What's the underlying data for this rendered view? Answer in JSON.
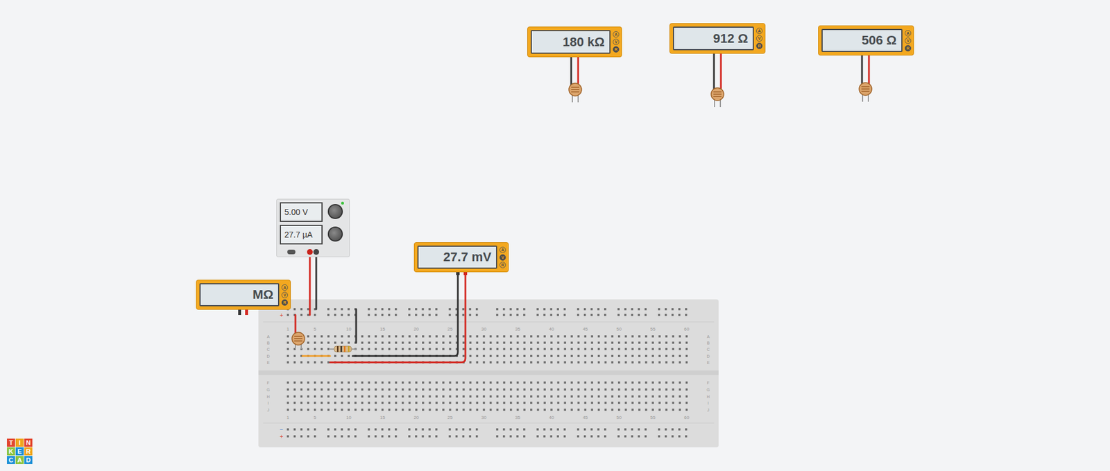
{
  "meters": [
    {
      "reading": "180 kΩ",
      "modes": [
        {
          "label": "A",
          "selected": false
        },
        {
          "label": "V",
          "selected": false
        },
        {
          "label": "R",
          "selected": true
        }
      ]
    },
    {
      "reading": "912 Ω",
      "modes": [
        {
          "label": "A",
          "selected": false
        },
        {
          "label": "V",
          "selected": false
        },
        {
          "label": "R",
          "selected": true
        }
      ]
    },
    {
      "reading": "506 Ω",
      "modes": [
        {
          "label": "A",
          "selected": false
        },
        {
          "label": "V",
          "selected": false
        },
        {
          "label": "R",
          "selected": true
        }
      ]
    },
    {
      "reading": "27.7 mV",
      "modes": [
        {
          "label": "A",
          "selected": false
        },
        {
          "label": "V",
          "selected": true
        },
        {
          "label": "R",
          "selected": false
        }
      ]
    },
    {
      "reading": "MΩ",
      "modes": [
        {
          "label": "A",
          "selected": false
        },
        {
          "label": "V",
          "selected": false
        },
        {
          "label": "R",
          "selected": true
        }
      ]
    }
  ],
  "power_supply": {
    "voltage": "5.00 V",
    "current": "27.7 µA",
    "on": true
  },
  "breadboard": {
    "columns": [
      "1",
      "5",
      "10",
      "15",
      "20",
      "25",
      "30",
      "35",
      "40",
      "45",
      "50",
      "55",
      "60"
    ],
    "rows_top": [
      "A",
      "B",
      "C",
      "D",
      "E"
    ],
    "rows_bottom": [
      "F",
      "G",
      "H",
      "I",
      "J"
    ],
    "rails_top": [
      "−",
      "+"
    ],
    "rails_bottom": [
      "−",
      "+"
    ]
  },
  "logo": [
    {
      "letter": "T",
      "color": "#e2452f"
    },
    {
      "letter": "I",
      "color": "#f0a51f"
    },
    {
      "letter": "N",
      "color": "#e2452f"
    },
    {
      "letter": "K",
      "color": "#8bc43f"
    },
    {
      "letter": "E",
      "color": "#1e90d6"
    },
    {
      "letter": "R",
      "color": "#f0a51f"
    },
    {
      "letter": "C",
      "color": "#1e90d6"
    },
    {
      "letter": "A",
      "color": "#8bc43f"
    },
    {
      "letter": "D",
      "color": "#1e90d6"
    }
  ]
}
